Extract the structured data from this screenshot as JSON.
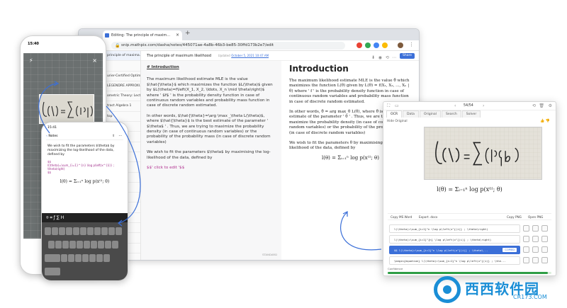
{
  "browser": {
    "tab_title": "Editing: The principle of maxim...",
    "url": "snip.mathpix.com/dasha/notes/445071ae-4a8b-46b3-be85-30ffd173b2e7/edit",
    "doc_title": "The principle of maximum likelihood",
    "updated_label": "Updated",
    "updated_date": "October 5, 2021 10:47 AM",
    "share_label": "Share",
    "colors": {
      "accent": "#3b6fd8",
      "tabbar": "#dee1e6"
    }
  },
  "sidebar": {
    "items": [
      "principle of maxima...",
      "",
      "urier-Certified Optim...",
      "LEGENDRE APPROXI...",
      "ometric Theory: Lectur...",
      "tract Algebra 1",
      "top",
      "tB+PY...",
      "PY...",
      "ds",
      "ed Sub...",
      "y",
      "ducer...",
      "ing dyna...",
      "ter limit R...",
      "grations",
      "ogic Ma...",
      "",
      "with ens...",
      ""
    ]
  },
  "editor": {
    "heading": "# Introduction",
    "paragraphs": [
      "The maximum likelihood estimate MLE is the value $\\hat{\\theta}$ which maximizes the function $L(\\theta)$ given by $L(\\theta)=f\\left(X_1, X_2, \\ldots, X_n \\mid \\theta\\right)$ where ' $f$ ' is the probability density function in case of continuous random variables and probability mass function in case of discrete random estimated.",
      "In other words, $\\hat{\\theta}=\\arg \\max _\\theta L(\\theta)$, where $\\hat{\\theta}$ is the best estimate of the parameter ' $\\theta$ ' . Thus, we are trying to maximize the probability density (in case of continuous random variables) or the probability of the probability mass (in case of discrete random variables)",
      "We wish to fit the parameters $\\theta$ by maximising the log-likelihood of the data, defined by"
    ],
    "click_text": "$$' click to edit '$$",
    "footer": "STANDARD"
  },
  "preview": {
    "title": "Introduction",
    "p1": "The maximum likelihood estimate MLE is the value θ̂ which maximizes the function L(θ) given by L(θ) = f(X₁, X₂, ..., Xₙ | θ) where ' f ' is the probability density function in case of continuous random variables and probability mass function in case of discrete random estimated.",
    "p2": "In other words, θ̂ = arg max_θ L(θ), where θ̂ is the best estimate of the parameter ' θ ' . Thus, we are trying to maximize the probability density (in case of continuous random variables) or the probability of the probability mass (in case of discrete random variables)",
    "p3": "We wish to fit the parameters θ by maximising the log-likelihood of the data, defined by",
    "formula": "l(θ) = Σᵢ₌₁ⁿ log p(x⁽ⁱ⁾; θ)"
  },
  "snip": {
    "page_counter": "54/54",
    "tabs": [
      "OCR",
      "Data",
      "Original",
      "Search",
      "Solver"
    ],
    "hide_original": "Hide Original",
    "formula": "l(θ) = Σᵢ₌₁ⁿ log p(x⁽ⁱ⁾; θ)",
    "copy_ms_word": "Copy MS Word",
    "export_docx": "Export .docx",
    "copy_png": "Copy PNG",
    "open_png": "Open PNG",
    "results": [
      "l(\\theta)=\\sum_{i=1}^n \\log p\\left(x^{(i)} ; \\theta\\right)",
      "l(\\theta)=\\sum_{i=1}^{n} \\log p\\left(x^{(i)} ; \\theta\\right)",
      "$$ l(\\theta)=\\sum_{i=1}^n \\log p\\left(x^{(i)} ; \\theta\\...",
      "\\begin{equation} l(\\theta)=\\sum_{i=1}^n \\log p\\left(x^{(i)} ; \\the..."
    ],
    "copied_label": "COPIED",
    "confidence_label": "Confidence",
    "confidence": 0.98
  },
  "phone_camera": {
    "time": "15:40"
  },
  "phone_notes": {
    "time": "15:41",
    "back_label": "Notes",
    "body": "We wish to fit the parameters $\\theta$ by maximizing the log-likelihood of the data, defined by",
    "latex1": "$$",
    "latex2": "l(\\theta)=\\sum_{i=1}^{n} \\log p\\left(x^{(i)} ; \\theta\\right)",
    "latex3": "$$",
    "formula": "l(θ) = Σᵢ₌₁ⁿ log p(x⁽ⁱ⁾; θ)",
    "toolbar": "⌾  ⌗  ƒ  ∑  H"
  },
  "watermark": {
    "cn": "西西软件园",
    "site": "CR173.COM"
  }
}
